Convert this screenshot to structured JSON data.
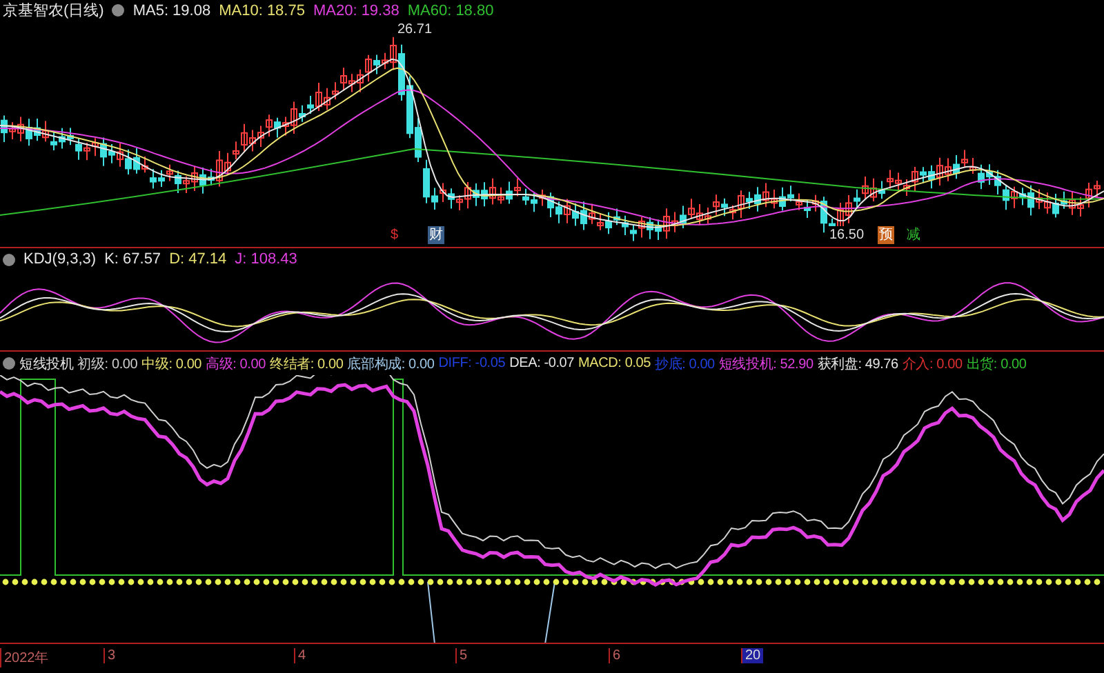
{
  "price_panel": {
    "title": "京基智农(日线)",
    "indicators": [
      {
        "label": "MA5: 19.08",
        "color": "#e6e6e6"
      },
      {
        "label": "MA10: 18.75",
        "color": "#e8e070"
      },
      {
        "label": "MA20: 19.38",
        "color": "#e040e0"
      },
      {
        "label": "MA60: 18.80",
        "color": "#30c030"
      }
    ],
    "high_label": "26.71",
    "low_label": "16.50",
    "markers": [
      {
        "text": "$",
        "kind": "glyph",
        "color": "#e03030"
      },
      {
        "text": "财",
        "kind": "tag",
        "color": "#3a5f8a"
      },
      {
        "text": "预",
        "kind": "tag",
        "color": "#c8641e"
      },
      {
        "text": "减",
        "kind": "glyph",
        "color": "#30c030"
      }
    ]
  },
  "kdj_panel": {
    "title": "KDJ(9,3,3)",
    "values": [
      {
        "label": "K: 67.57",
        "color": "#e6e6e6"
      },
      {
        "label": "D: 47.14",
        "color": "#e8e070"
      },
      {
        "label": "J: 108.43",
        "color": "#e040e0"
      }
    ]
  },
  "signal_panel": {
    "title": "短线投机",
    "values": [
      {
        "label": "初级: 0.00",
        "color": "#d0d0d0"
      },
      {
        "label": "中级: 0.00",
        "color": "#e8e070"
      },
      {
        "label": "高级: 0.00",
        "color": "#e040e0"
      },
      {
        "label": "终结者: 0.00",
        "color": "#e8e070"
      },
      {
        "label": "底部构成: 0.00",
        "color": "#a0c8e8"
      },
      {
        "label": "DIFF: -0.05",
        "color": "#2040e0"
      },
      {
        "label": "DEA: -0.07",
        "color": "#e6e6e6"
      },
      {
        "label": "MACD: 0.05",
        "color": "#e8e070"
      },
      {
        "label": "抄底: 0.00",
        "color": "#2040e0"
      },
      {
        "label": "短线投机: 52.90",
        "color": "#e040e0"
      },
      {
        "label": "获利盘: 49.76",
        "color": "#e6e6e6"
      },
      {
        "label": "介入: 0.00",
        "color": "#e03030"
      },
      {
        "label": "出货: 0.00",
        "color": "#30c030"
      }
    ]
  },
  "x_axis": {
    "labels": [
      {
        "text": "2022年",
        "selected": false
      },
      {
        "text": "3",
        "selected": false
      },
      {
        "text": "4",
        "selected": false
      },
      {
        "text": "5",
        "selected": false
      },
      {
        "text": "6",
        "selected": false
      },
      {
        "text": "20",
        "selected": true
      }
    ]
  }
}
